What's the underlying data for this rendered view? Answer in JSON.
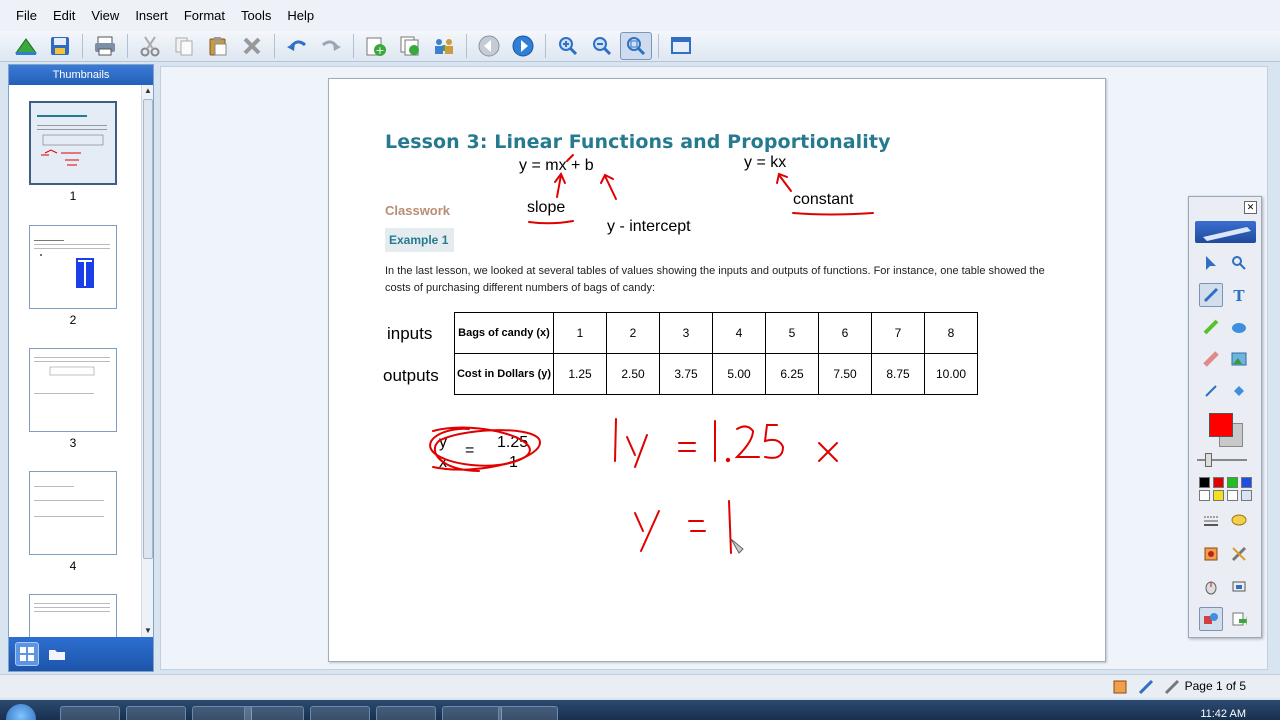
{
  "menu": [
    "File",
    "Edit",
    "View",
    "Insert",
    "Format",
    "Tools",
    "Help"
  ],
  "toolbar": {
    "buttons": [
      "open-icon",
      "save-icon",
      "print-icon",
      "cut-icon",
      "copy-icon",
      "paste-icon",
      "delete-icon",
      "undo-icon",
      "redo-icon",
      "add-page-icon",
      "insert-page-icon",
      "users-icon",
      "previous-page-icon",
      "next-page-icon",
      "zoom-in-icon",
      "zoom-out-icon",
      "zoom-fit-icon",
      "display-icon"
    ]
  },
  "sidebar": {
    "title": "Thumbnails",
    "pages": [
      {
        "number": "1",
        "selected": true
      },
      {
        "number": "2",
        "selected": false
      },
      {
        "number": "3",
        "selected": false
      },
      {
        "number": "4",
        "selected": false
      }
    ]
  },
  "page": {
    "title": "Lesson 3:  Linear Functions and Proportionality",
    "classwork": "Classwork",
    "example": "Example 1",
    "intro": "In the last lesson, we looked at several tables of values showing the inputs and outputs of functions.  For instance, one table showed the costs of purchasing different numbers of bags of candy:",
    "row_labels": {
      "inputs": "inputs",
      "outputs": "outputs"
    },
    "table": {
      "row1_header": "Bags of candy (x)",
      "row1": [
        "1",
        "2",
        "3",
        "4",
        "5",
        "6",
        "7",
        "8"
      ],
      "row2_header": "Cost in Dollars (y)",
      "row2": [
        "1.25",
        "2.50",
        "3.75",
        "5.00",
        "6.25",
        "7.50",
        "8.75",
        "10.00"
      ]
    },
    "annotations": {
      "slope_form": "y = mx + b",
      "proportional_form": "y = kx",
      "slope": "slope",
      "intercept": "y - intercept",
      "constant": "constant",
      "fraction_top_left": "y",
      "fraction_top_right": "1.25",
      "fraction_bottom_left": "x",
      "fraction_bottom_right": "1",
      "fraction_eq": "="
    }
  },
  "palette": {
    "foreground_color": "#ff0000",
    "background_color": "#c9c9c9"
  },
  "status": {
    "page_indicator": "Page 1 of 5"
  },
  "taskbar": {
    "clock": "11:42 AM"
  }
}
